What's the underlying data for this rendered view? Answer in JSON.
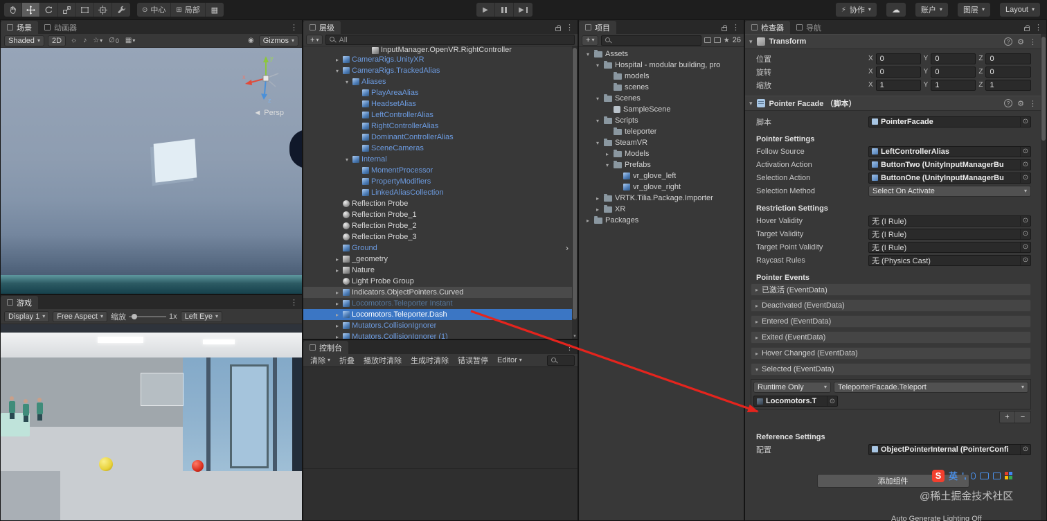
{
  "toolbar": {
    "tools": [
      {
        "name": "hand-tool",
        "active": false
      },
      {
        "name": "move-tool",
        "active": true
      },
      {
        "name": "rotate-tool",
        "active": false
      },
      {
        "name": "scale-tool",
        "active": false
      },
      {
        "name": "rect-tool",
        "active": false
      },
      {
        "name": "transform-tool",
        "active": false
      },
      {
        "name": "custom-tool",
        "active": false
      }
    ],
    "pivot_label": "中心",
    "space_label": "局部",
    "collab_label": "协作",
    "account_label": "账户",
    "layers_label": "图层",
    "layout_label": "Layout"
  },
  "scene": {
    "tab_scene": "场景",
    "tab_animator": "动画器",
    "shading": "Shaded",
    "toggle_2d": "2D",
    "hidden_count": "0",
    "gizmos": "Gizmos",
    "persp": "Persp",
    "axes": {
      "x": "x",
      "y": "y",
      "z": "z"
    }
  },
  "game": {
    "tab": "游戏",
    "display": "Display 1",
    "aspect": "Free Aspect",
    "zoom_label": "缩放",
    "zoom_value": "1x",
    "eye": "Left Eye"
  },
  "hierarchy": {
    "tab": "层级",
    "search_placeholder": "All",
    "items": [
      {
        "label": "InputManager.OpenVR.RightController",
        "depth": 4,
        "style": "white",
        "icon": "cube",
        "partial": true
      },
      {
        "label": "CameraRigs.UnityXR",
        "depth": 1,
        "arrow": "closed",
        "style": "blue",
        "icon": "prefab"
      },
      {
        "label": "CameraRigs.TrackedAlias",
        "depth": 1,
        "arrow": "open",
        "style": "blue",
        "icon": "prefab"
      },
      {
        "label": "Aliases",
        "depth": 2,
        "arrow": "open",
        "style": "blue",
        "icon": "prefab"
      },
      {
        "label": "PlayAreaAlias",
        "depth": 3,
        "style": "blue",
        "icon": "prefab"
      },
      {
        "label": "HeadsetAlias",
        "depth": 3,
        "style": "blue",
        "icon": "prefab"
      },
      {
        "label": "LeftControllerAlias",
        "depth": 3,
        "style": "blue",
        "icon": "prefab"
      },
      {
        "label": "RightControllerAlias",
        "depth": 3,
        "style": "blue",
        "icon": "prefab"
      },
      {
        "label": "DominantControllerAlias",
        "depth": 3,
        "style": "blue",
        "icon": "prefab"
      },
      {
        "label": "SceneCameras",
        "depth": 3,
        "style": "blue",
        "icon": "prefab"
      },
      {
        "label": "Internal",
        "depth": 2,
        "arrow": "open",
        "style": "blue",
        "icon": "prefab"
      },
      {
        "label": "MomentProcessor",
        "depth": 3,
        "style": "blue",
        "icon": "prefab"
      },
      {
        "label": "PropertyModifiers",
        "depth": 3,
        "style": "blue",
        "icon": "prefab"
      },
      {
        "label": "LinkedAliasCollection",
        "depth": 3,
        "style": "blue",
        "icon": "prefab"
      },
      {
        "label": "Reflection Probe",
        "depth": 1,
        "style": "white",
        "icon": "probe"
      },
      {
        "label": "Reflection Probe_1",
        "depth": 1,
        "style": "white",
        "icon": "probe"
      },
      {
        "label": "Reflection Probe_2",
        "depth": 1,
        "style": "white",
        "icon": "probe"
      },
      {
        "label": "Reflection Probe_3",
        "depth": 1,
        "style": "white",
        "icon": "probe"
      },
      {
        "label": "Ground",
        "depth": 1,
        "style": "blue",
        "icon": "prefab",
        "open_arrow": true
      },
      {
        "label": "_geometry",
        "depth": 1,
        "arrow": "closed",
        "style": "white",
        "icon": "cube"
      },
      {
        "label": "Nature",
        "depth": 1,
        "arrow": "closed",
        "style": "white",
        "icon": "cube"
      },
      {
        "label": "Light Probe Group",
        "depth": 1,
        "style": "white",
        "icon": "probe"
      },
      {
        "label": "Indicators.ObjectPointers.Curved",
        "depth": 1,
        "arrow": "closed",
        "style": "white",
        "icon": "prefab",
        "bg": "hover"
      },
      {
        "label": "Locomotors.Teleporter Instant",
        "depth": 1,
        "arrow": "closed",
        "style": "dim",
        "icon": "prefab"
      },
      {
        "label": "Locomotors.Teleporter.Dash",
        "depth": 1,
        "arrow": "closed",
        "style": "sel",
        "icon": "prefab",
        "bg": "selected"
      },
      {
        "label": "Mutators.CollisionIgnorer",
        "depth": 1,
        "arrow": "closed",
        "style": "blue",
        "icon": "prefab"
      },
      {
        "label": "Mutators.CollisionIgnorer (1)",
        "depth": 1,
        "arrow": "closed",
        "style": "blue",
        "icon": "prefab"
      }
    ]
  },
  "console": {
    "tab": "控制台",
    "clear": "清除",
    "collapse": "折叠",
    "clear_on_play": "播放时清除",
    "clear_on_build": "生成时清除",
    "error_pause": "错误暂停",
    "editor": "Editor"
  },
  "project": {
    "tab": "项目",
    "badge": "26",
    "items": [
      {
        "label": "Assets",
        "depth": 0,
        "arrow": "open",
        "icon": "folder"
      },
      {
        "label": "Hospital - modular building, pro",
        "depth": 1,
        "arrow": "open",
        "icon": "folder"
      },
      {
        "label": "models",
        "depth": 2,
        "icon": "folder"
      },
      {
        "label": "scenes",
        "depth": 2,
        "icon": "folder"
      },
      {
        "label": "Scenes",
        "depth": 1,
        "arrow": "open",
        "icon": "folder"
      },
      {
        "label": "SampleScene",
        "depth": 2,
        "icon": "scene"
      },
      {
        "label": "Scripts",
        "depth": 1,
        "arrow": "open",
        "icon": "folder"
      },
      {
        "label": "teleporter",
        "depth": 2,
        "icon": "folder"
      },
      {
        "label": "SteamVR",
        "depth": 1,
        "arrow": "open",
        "icon": "folder"
      },
      {
        "label": "Models",
        "depth": 2,
        "arrow": "closed",
        "icon": "folder"
      },
      {
        "label": "Prefabs",
        "depth": 2,
        "arrow": "open",
        "icon": "folder"
      },
      {
        "label": "vr_glove_left",
        "depth": 3,
        "icon": "prefab"
      },
      {
        "label": "vr_glove_right",
        "depth": 3,
        "icon": "prefab"
      },
      {
        "label": "VRTK.Tilia.Package.Importer",
        "depth": 1,
        "arrow": "closed",
        "icon": "folder"
      },
      {
        "label": "XR",
        "depth": 1,
        "arrow": "closed",
        "icon": "folder"
      },
      {
        "label": "Packages",
        "depth": 0,
        "arrow": "closed",
        "icon": "folder"
      }
    ]
  },
  "inspector": {
    "tab_inspector": "检查器",
    "tab_nav": "导航",
    "transform": {
      "title": "Transform",
      "position_label": "位置",
      "rotation_label": "旋转",
      "scale_label": "缩放",
      "x": "X",
      "y": "Y",
      "z": "Z",
      "position": {
        "x": "0",
        "y": "0",
        "z": "0"
      },
      "rotation": {
        "x": "0",
        "y": "0",
        "z": "0"
      },
      "scale": {
        "x": "1",
        "y": "1",
        "z": "1"
      }
    },
    "pointer": {
      "title": "Pointer Facade （脚本）",
      "script_label": "脚本",
      "script_value": "PointerFacade",
      "settings_title": "Pointer Settings",
      "follow_source_label": "Follow Source",
      "follow_source_value": "LeftControllerAlias",
      "activation_label": "Activation Action",
      "activation_value": "ButtonTwo (UnityInputManagerBu",
      "selection_action_label": "Selection Action",
      "selection_action_value": "ButtonOne (UnityInputManagerBu",
      "selection_method_label": "Selection Method",
      "selection_method_value": "Select On Activate",
      "restriction_title": "Restriction Settings",
      "hover_label": "Hover Validity",
      "hover_value": "无 (I Rule)",
      "target_label": "Target Validity",
      "target_value": "无 (I Rule)",
      "target_point_label": "Target Point Validity",
      "target_point_value": "无 (I Rule)",
      "raycast_label": "Raycast Rules",
      "raycast_value": "无 (Physics Cast)",
      "events_title": "Pointer Events",
      "events": [
        "已激活 (EventData)",
        "Deactivated (EventData)",
        "Entered (EventData)",
        "Exited (EventData)",
        "Hover Changed (EventData)"
      ],
      "selected_event_label": "Selected (EventData)",
      "selected_mode": "Runtime Only",
      "selected_function": "TeleporterFacade.Teleport",
      "selected_target": "Locomotors.T",
      "reference_title": "Reference Settings",
      "config_label": "配置",
      "config_value": "ObjectPointerInternal (PointerConfi"
    },
    "add_component": "添加组件",
    "lighting_status": "Auto Generate Lighting Off"
  },
  "watermark": {
    "ime_logo": "S",
    "ime_lang": "英",
    "ime_marks": "',",
    "credit": "@稀土掘金技术社区"
  },
  "colors": {
    "selection_blue": "#3B76C4",
    "prefab_text_blue": "#6C9BE0",
    "arrow_red": "#E5241D"
  }
}
